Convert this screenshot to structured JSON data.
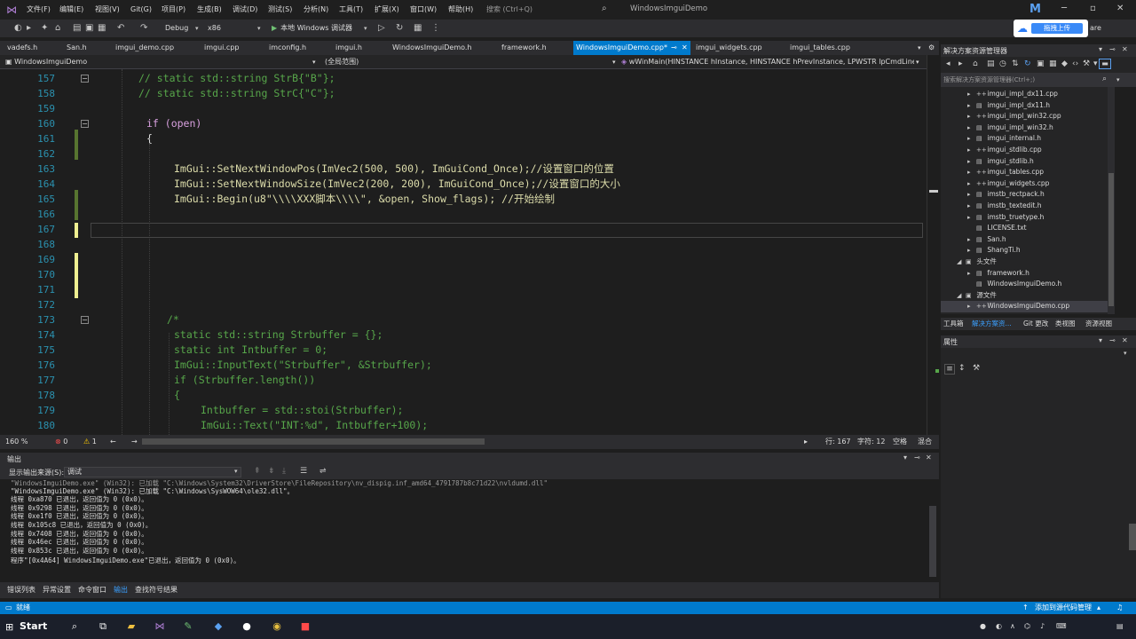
{
  "menu": {
    "items": [
      "文件(F)",
      "编辑(E)",
      "视图(V)",
      "Git(G)",
      "项目(P)",
      "生成(B)",
      "调试(D)",
      "测试(S)",
      "分析(N)",
      "工具(T)",
      "扩展(X)",
      "窗口(W)",
      "帮助(H)"
    ],
    "search_placeholder": "搜索 (Ctrl+Q)",
    "window_title": "WindowsImguiDemo",
    "user_initial": "M"
  },
  "toolbar": {
    "config": "Debug",
    "platform": "x86",
    "run_label": "本地 Windows 调试器",
    "upload_label": "拖拽上传",
    "share_label": "are"
  },
  "tabs": [
    {
      "label": "vadefs.h"
    },
    {
      "label": "San.h"
    },
    {
      "label": "imgui_demo.cpp"
    },
    {
      "label": "imgui.cpp"
    },
    {
      "label": "imconfig.h"
    },
    {
      "label": "imgui.h"
    },
    {
      "label": "WindowsImguiDemo.h"
    },
    {
      "label": "framework.h"
    },
    {
      "label": "WindowsImguiDemo.cpp*"
    },
    {
      "label": "imgui_widgets.cpp"
    },
    {
      "label": "imgui_tables.cpp"
    }
  ],
  "navbar": {
    "project": "WindowsImguiDemo",
    "scope": "(全局范围)",
    "member": "wWinMain(HINSTANCE hInstance, HINSTANCE hPrevInstance, LPWSTR lpCmdLine,"
  },
  "code_lines": [
    {
      "num": "157",
      "text": "// static std::string StrB{\"B\"};"
    },
    {
      "num": "158",
      "text": "// static std::string StrC{\"C\"};"
    },
    {
      "num": "159",
      "text": ""
    },
    {
      "num": "160",
      "text": "if (open)"
    },
    {
      "num": "161",
      "text": "{"
    },
    {
      "num": "162",
      "text": ""
    },
    {
      "num": "163",
      "text": "ImGui::SetNextWindowPos(ImVec2(500, 500), ImGuiCond_Once);//设置窗口的位置"
    },
    {
      "num": "164",
      "text": "ImGui::SetNextWindowSize(ImVec2(200, 200), ImGuiCond_Once);//设置窗口的大小"
    },
    {
      "num": "165",
      "text": "ImGui::Begin(u8\"\\\\\\\\XXX脚本\\\\\\\\\", &open, Show_flags); //开始绘制"
    },
    {
      "num": "166",
      "text": ""
    },
    {
      "num": "167",
      "text": ""
    },
    {
      "num": "168",
      "text": ""
    },
    {
      "num": "169",
      "text": ""
    },
    {
      "num": "170",
      "text": ""
    },
    {
      "num": "171",
      "text": ""
    },
    {
      "num": "172",
      "text": ""
    },
    {
      "num": "173",
      "text": "/*"
    },
    {
      "num": "174",
      "text": "static std::string Strbuffer = {};"
    },
    {
      "num": "175",
      "text": "static int Intbuffer = 0;"
    },
    {
      "num": "176",
      "text": "ImGui::InputText(\"Strbuffer\", &Strbuffer);"
    },
    {
      "num": "177",
      "text": "if (Strbuffer.length())"
    },
    {
      "num": "178",
      "text": "{"
    },
    {
      "num": "179",
      "text": "Intbuffer = std::stoi(Strbuffer);"
    },
    {
      "num": "180",
      "text": "ImGui::Text(\"INT:%d\", Intbuffer+100);"
    }
  ],
  "editor_status": {
    "zoom": "160 %",
    "errors": "0",
    "warnings": "1",
    "line": "行: 167",
    "col": "字符: 12",
    "mode": "空格",
    "eol": "混合"
  },
  "output": {
    "title": "输出",
    "source_label": "显示输出来源(S):",
    "source_value": "调试",
    "lines": [
      "\"WindowsImguiDemo.exe\" (Win32): 已加载 \"C:\\Windows\\System32\\DriverStore\\FileRepository\\nv_dispig.inf_amd64_4791787b8c71d22\\nvldumd.dll\"",
      "\"WindowsImguiDemo.exe\" (Win32): 已加载 \"C:\\Windows\\SysWOW64\\ole32.dll\"。",
      "线程 0xa870 已退出，返回值为 0 (0x0)。",
      "线程 0x9298 已退出，返回值为 0 (0x0)。",
      "线程 0xe1f0 已退出，返回值为 0 (0x0)。",
      "线程 0x105c8 已退出，返回值为 0 (0x0)。",
      "线程 0x7408 已退出，返回值为 0 (0x0)。",
      "线程 0x46ec 已退出，返回值为 0 (0x0)。",
      "线程 0x853c 已退出，返回值为 0 (0x0)。",
      "程序\"[0x4A64] WindowsImguiDemo.exe\"已退出，返回值为 0 (0x0)。"
    ]
  },
  "bottom_tabs": [
    "错误列表",
    "异常设置",
    "命令窗口",
    "输出",
    "查找符号结果"
  ],
  "solution": {
    "title": "解决方案资源管理器",
    "search_placeholder": "搜索解决方案资源管理器(Ctrl+;)",
    "items": [
      {
        "label": "imgui_impl_dx11.cpp",
        "indent": 2,
        "arrow": "▸",
        "icon": "++"
      },
      {
        "label": "imgui_impl_dx11.h",
        "indent": 2,
        "arrow": "▸",
        "icon": "▤"
      },
      {
        "label": "imgui_impl_win32.cpp",
        "indent": 2,
        "arrow": "▸",
        "icon": "++"
      },
      {
        "label": "imgui_impl_win32.h",
        "indent": 2,
        "arrow": "▸",
        "icon": "▤"
      },
      {
        "label": "imgui_internal.h",
        "indent": 2,
        "arrow": "▸",
        "icon": "▤"
      },
      {
        "label": "imgui_stdlib.cpp",
        "indent": 2,
        "arrow": "▸",
        "icon": "++"
      },
      {
        "label": "imgui_stdlib.h",
        "indent": 2,
        "arrow": "▸",
        "icon": "▤"
      },
      {
        "label": "imgui_tables.cpp",
        "indent": 2,
        "arrow": "▸",
        "icon": "++"
      },
      {
        "label": "imgui_widgets.cpp",
        "indent": 2,
        "arrow": "▸",
        "icon": "++"
      },
      {
        "label": "imstb_rectpack.h",
        "indent": 2,
        "arrow": "▸",
        "icon": "▤"
      },
      {
        "label": "imstb_textedit.h",
        "indent": 2,
        "arrow": "▸",
        "icon": "▤"
      },
      {
        "label": "imstb_truetype.h",
        "indent": 2,
        "arrow": "▸",
        "icon": "▤"
      },
      {
        "label": "LICENSE.txt",
        "indent": 2,
        "arrow": "",
        "icon": "▤"
      },
      {
        "label": "San.h",
        "indent": 2,
        "arrow": "▸",
        "icon": "▤"
      },
      {
        "label": "ShangTi.h",
        "indent": 2,
        "arrow": "▸",
        "icon": "▤"
      },
      {
        "label": "头文件",
        "indent": 1,
        "arrow": "◢",
        "icon": "▣"
      },
      {
        "label": "framework.h",
        "indent": 2,
        "arrow": "▸",
        "icon": "▤"
      },
      {
        "label": "WindowsImguiDemo.h",
        "indent": 2,
        "arrow": "",
        "icon": "▤"
      },
      {
        "label": "源文件",
        "indent": 1,
        "arrow": "◢",
        "icon": "▣"
      },
      {
        "label": "WindowsImguiDemo.cpp",
        "indent": 2,
        "arrow": "▸",
        "icon": "++",
        "selected": true
      }
    ],
    "tabs": [
      "工具箱",
      "解决方案资...",
      "Git 更改",
      "类视图",
      "资源视图"
    ]
  },
  "properties": {
    "title": "属性"
  },
  "statusbar": {
    "ready": "就绪",
    "source_control": "添加到源代码管理"
  },
  "taskbar": {
    "start": "Start"
  }
}
